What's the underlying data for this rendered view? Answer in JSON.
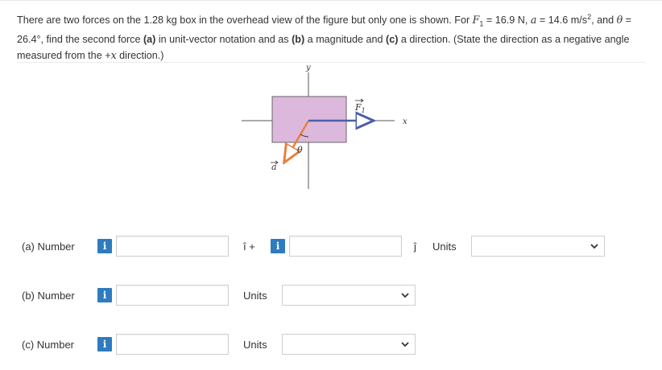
{
  "question": {
    "text1": "There are two forces on the 1.28 kg box in the overhead view of the figure but only one is shown. For ",
    "F1_sym": "F",
    "F1_sub": "1",
    "text2": " = 16.9 N, ",
    "a_sym": "a",
    "text3": " = 14.6 m/s",
    "sup2": "2",
    "text4": ", and ",
    "theta_sym": "θ",
    "text5": " = 26.4°, find the second force ",
    "a_part": "(a)",
    "text6": " in unit-vector notation and as ",
    "b_part": "(b)",
    "text7": " a magnitude and ",
    "c_part": "(c)",
    "text8": " a direction. (State the direction as a negative angle measured from the +",
    "x_sym": "x",
    "text9": " direction.)"
  },
  "figure": {
    "y_label": "y",
    "x_label": "x",
    "f1_label": "F",
    "f1_sub": "1",
    "theta_label": "θ",
    "a_label": "a",
    "colors": {
      "box": "#dcb8dc",
      "force": "#4b5faa",
      "accel": "#e8803a"
    }
  },
  "rows": {
    "a": {
      "label": "(a)  Number",
      "i_hat": "î +",
      "j_hat": "ĵ",
      "units": "Units",
      "value_i": "",
      "value_j": "",
      "units_value": ""
    },
    "b": {
      "label": "(b)  Number",
      "units": "Units",
      "value": "",
      "units_value": ""
    },
    "c": {
      "label": "(c)  Number",
      "units": "Units",
      "value": "",
      "units_value": ""
    }
  },
  "info_glyph": "i"
}
